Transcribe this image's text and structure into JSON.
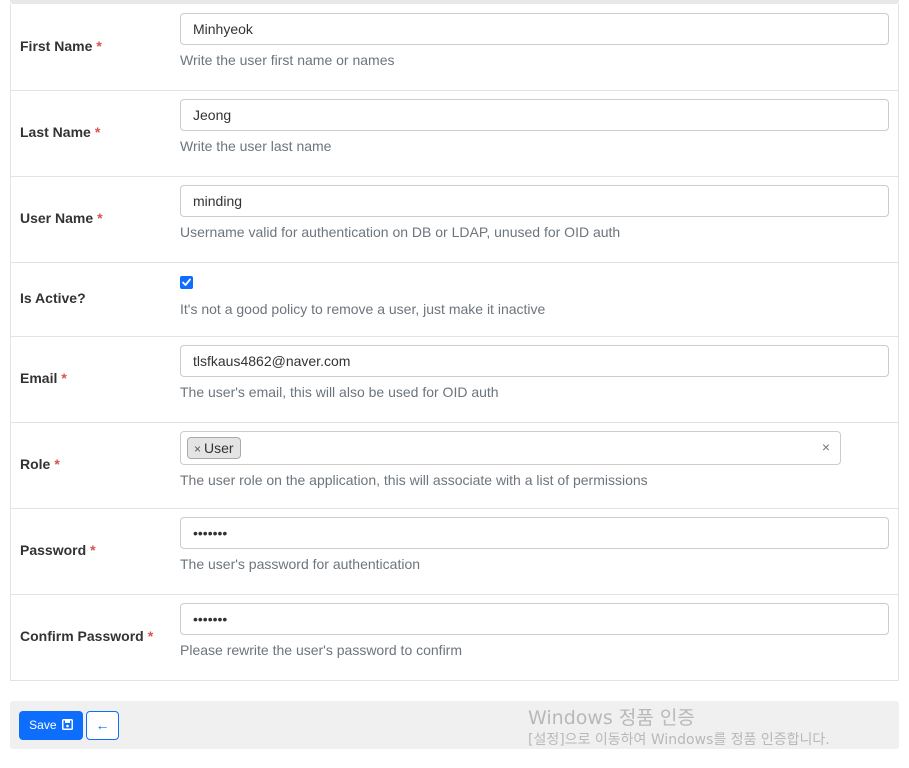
{
  "form": {
    "first_name": {
      "label": "First Name",
      "required_mark": "*",
      "value": "Minhyeok",
      "help": "Write the user first name or names"
    },
    "last_name": {
      "label": "Last Name",
      "required_mark": "*",
      "value": "Jeong",
      "help": "Write the user last name"
    },
    "user_name": {
      "label": "User Name",
      "required_mark": "*",
      "value": "minding",
      "help": "Username valid for authentication on DB or LDAP, unused for OID auth"
    },
    "is_active": {
      "label": "Is Active?",
      "checked": true,
      "help": "It's not a good policy to remove a user, just make it inactive"
    },
    "email": {
      "label": "Email",
      "required_mark": "*",
      "value": "tlsfkaus4862@naver.com",
      "help": "The user's email, this will also be used for OID auth"
    },
    "role": {
      "label": "Role",
      "required_mark": "*",
      "chip_remove": "×",
      "selected": "User",
      "clear": "×",
      "help": "The user role on the application, this will associate with a list of permissions"
    },
    "password": {
      "label": "Password",
      "required_mark": "*",
      "value": "•••••••",
      "help": "The user's password for authentication"
    },
    "confirm_password": {
      "label": "Confirm Password",
      "required_mark": "*",
      "value": "•••••••",
      "help": "Please rewrite the user's password to confirm"
    }
  },
  "footer": {
    "save_label": "Save",
    "save_icon": "floppy-disk-icon",
    "back_icon": "arrow-left-icon",
    "back_glyph": "←"
  },
  "watermark": {
    "title": "Windows 정품 인증",
    "subtitle": "[설정]으로 이동하여 Windows를 정품 인증합니다."
  },
  "colors": {
    "primary": "#0d6efd",
    "required": "#d9534f",
    "help_text": "#6c757d"
  }
}
